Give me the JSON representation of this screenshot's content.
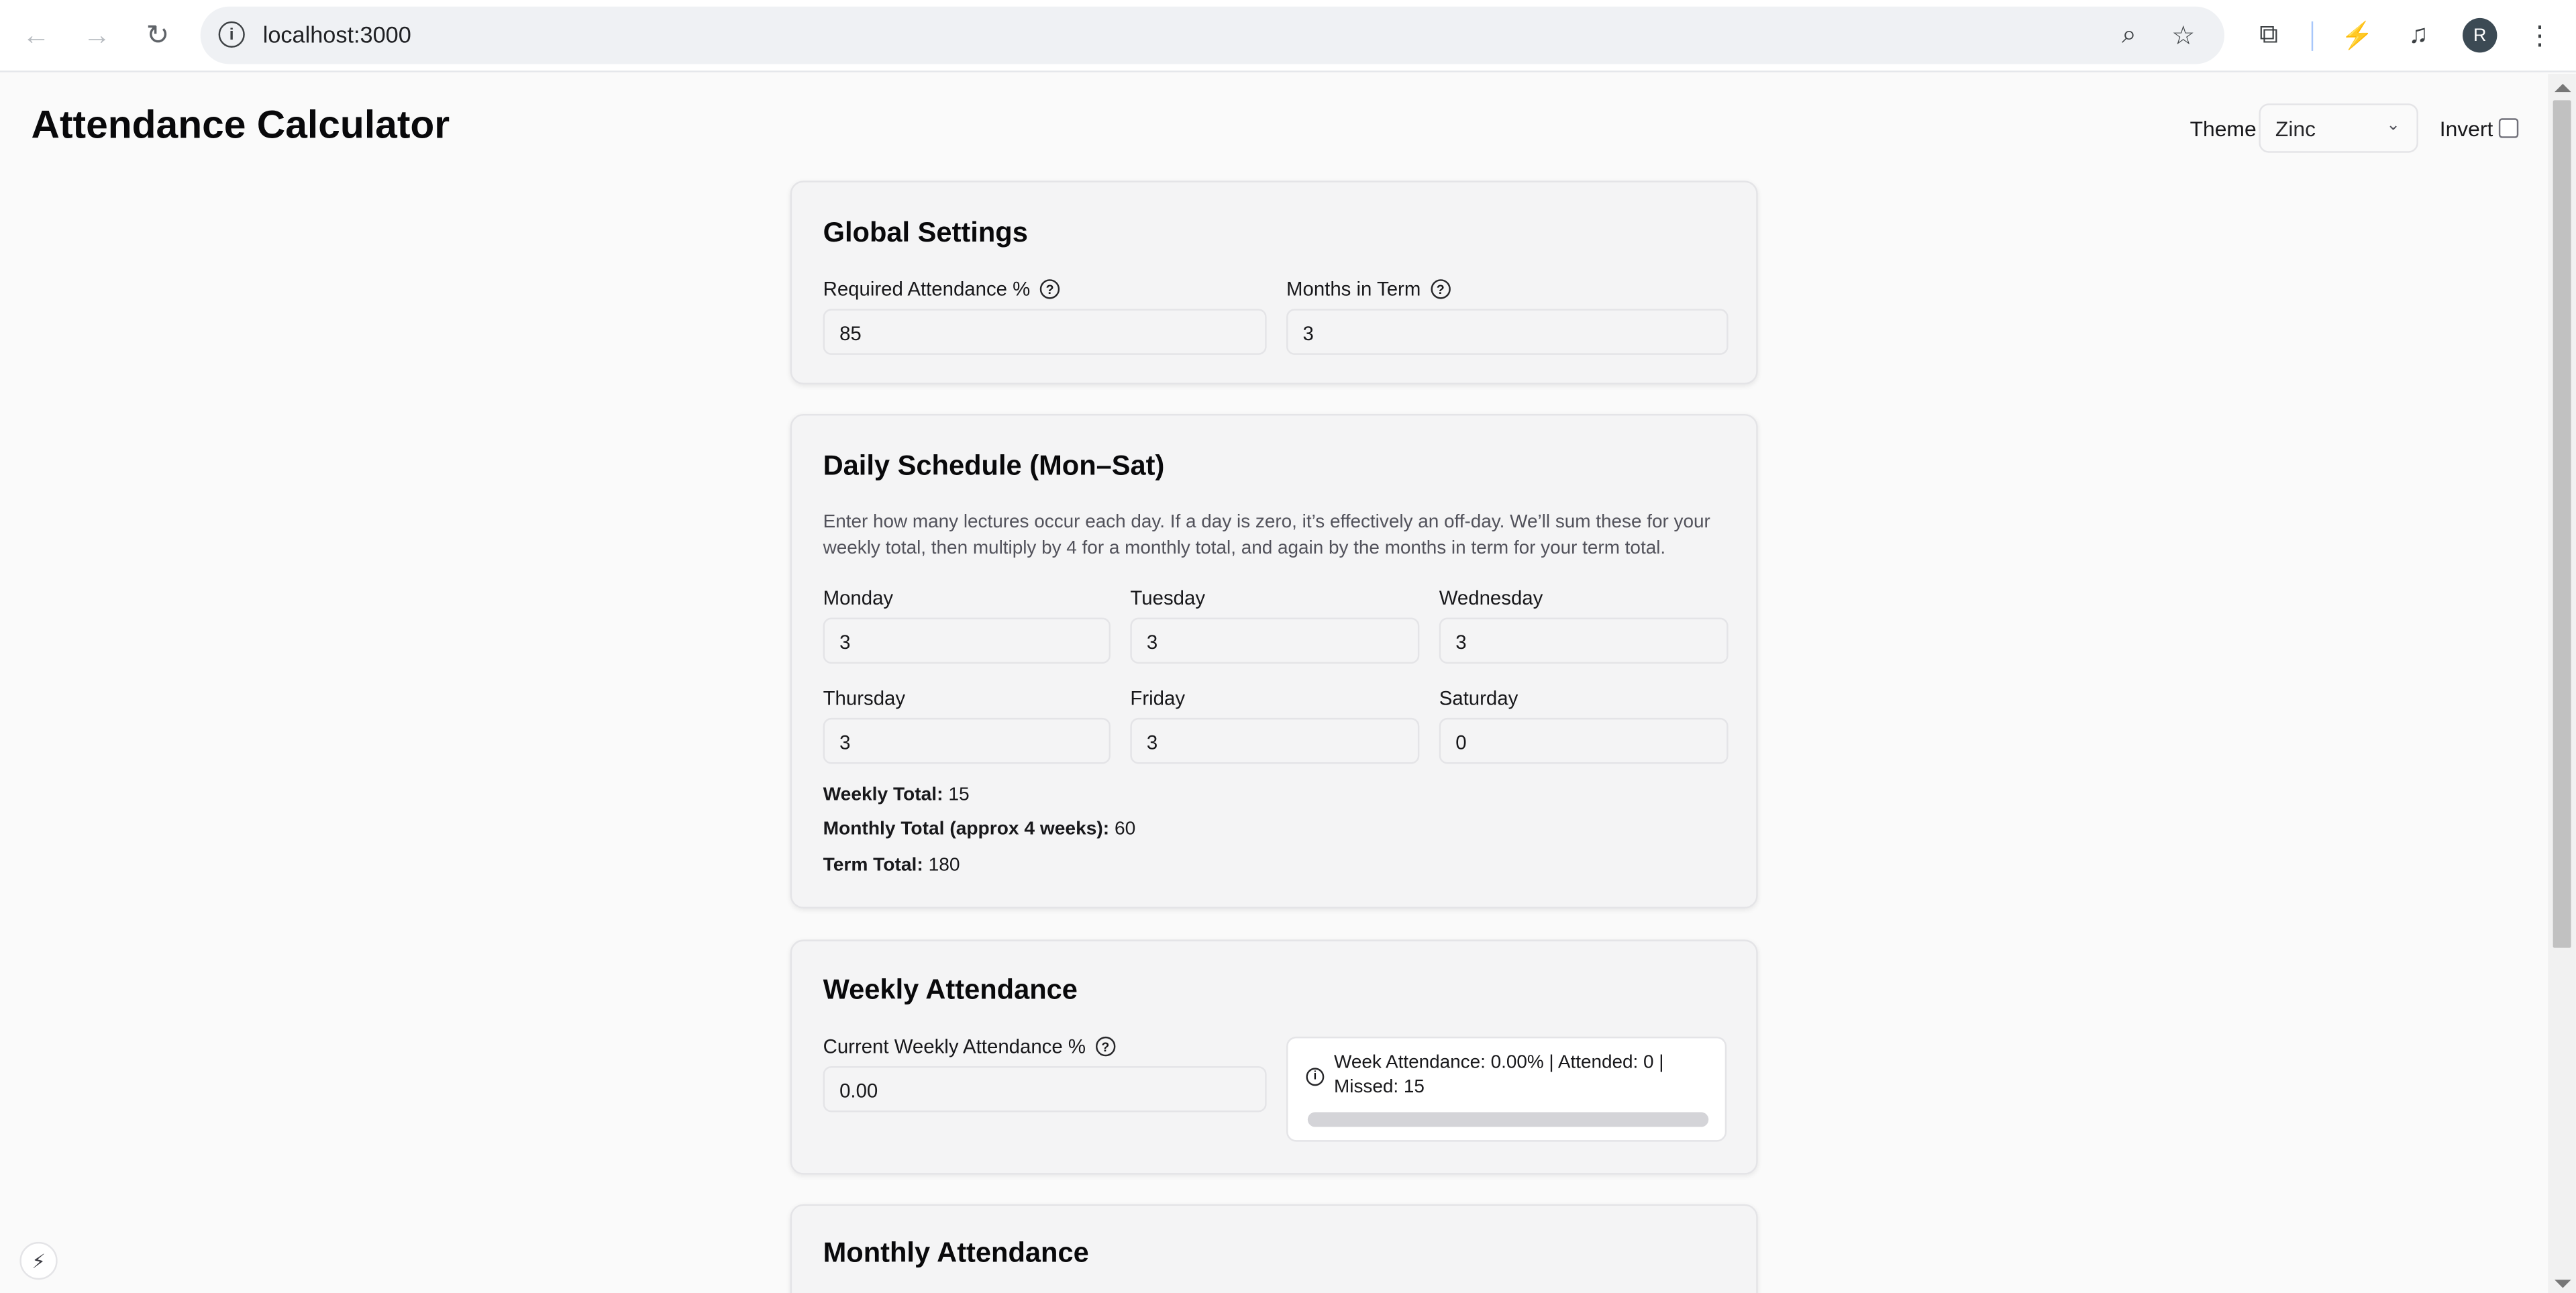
{
  "browser": {
    "url": "localhost:3000",
    "avatar_initial": "R",
    "icons": {
      "back": "←",
      "forward": "→",
      "reload": "↻",
      "info": "i",
      "zoom": "⌕",
      "bookmark": "☆",
      "extensions": "⧉",
      "performance": "⚡",
      "media": "♫",
      "menu": "⋮"
    }
  },
  "header": {
    "title": "Attendance Calculator",
    "theme_label": "Theme",
    "theme_value": "Zinc",
    "invert_label": "Invert",
    "invert_checked": false
  },
  "global_settings": {
    "title": "Global Settings",
    "required_label": "Required Attendance %",
    "required_value": "85",
    "months_label": "Months in Term",
    "months_value": "3"
  },
  "daily_schedule": {
    "title": "Daily Schedule (Mon–Sat)",
    "description": "Enter how many lectures occur each day. If a day is zero, it’s effectively an off-day. We’ll sum these for your weekly total, then multiply by 4 for a monthly total, and again by the months in term for your term total.",
    "days": [
      {
        "label": "Monday",
        "value": "3"
      },
      {
        "label": "Tuesday",
        "value": "3"
      },
      {
        "label": "Wednesday",
        "value": "3"
      },
      {
        "label": "Thursday",
        "value": "3"
      },
      {
        "label": "Friday",
        "value": "3"
      },
      {
        "label": "Saturday",
        "value": "0"
      }
    ],
    "weekly_total_label": "Weekly Total:",
    "weekly_total_value": "15",
    "monthly_total_label": "Monthly Total (approx 4 weeks):",
    "monthly_total_value": "60",
    "term_total_label": "Term Total:",
    "term_total_value": "180"
  },
  "weekly_attendance": {
    "title": "Weekly Attendance",
    "current_label": "Current Weekly Attendance %",
    "current_value": "0.00",
    "summary": "Week Attendance: 0.00% | Attended: 0 | Missed: 15",
    "progress_fraction": 0
  },
  "monthly_attendance": {
    "title": "Monthly Attendance"
  },
  "colors": {
    "background": "#fafafa",
    "card": "#f4f4f5",
    "border": "#e4e4e7",
    "progress_track": "#d4d4d8",
    "text": "#18181b"
  }
}
